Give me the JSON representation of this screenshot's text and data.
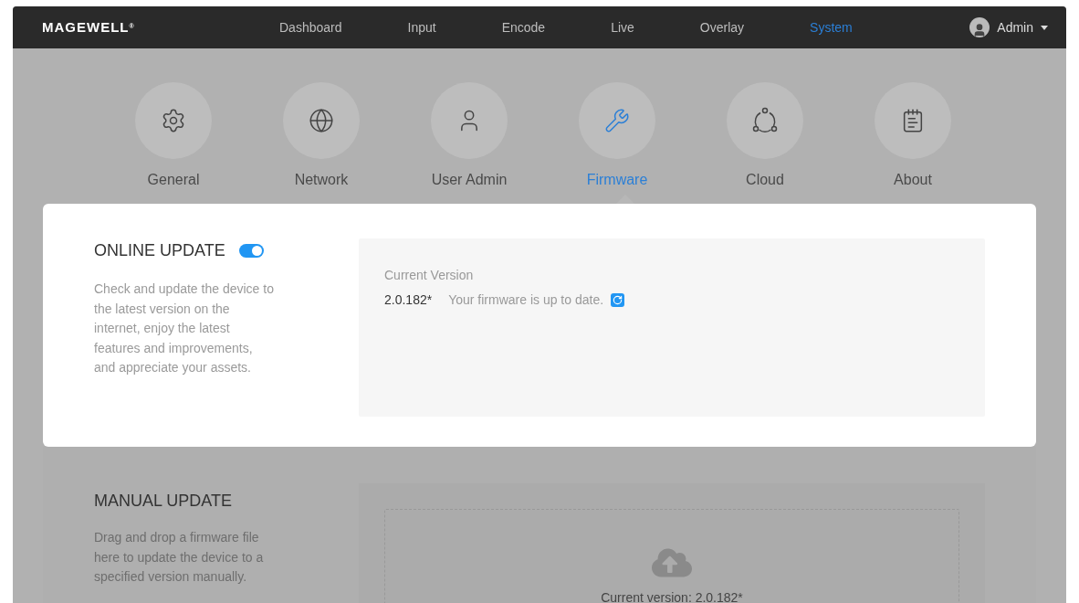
{
  "brand": "MAGEWELL",
  "brand_mark": "®",
  "nav": [
    {
      "label": "Dashboard",
      "selected": false
    },
    {
      "label": "Input",
      "selected": false
    },
    {
      "label": "Encode",
      "selected": false
    },
    {
      "label": "Live",
      "selected": false
    },
    {
      "label": "Overlay",
      "selected": false
    },
    {
      "label": "System",
      "selected": true
    }
  ],
  "user": {
    "name": "Admin"
  },
  "system_tabs": [
    {
      "kind": "gear",
      "label": "General",
      "selected": false
    },
    {
      "kind": "globe",
      "label": "Network",
      "selected": false
    },
    {
      "kind": "user",
      "label": "User Admin",
      "selected": false
    },
    {
      "kind": "tools",
      "label": "Firmware",
      "selected": true
    },
    {
      "kind": "nodes",
      "label": "Cloud",
      "selected": false
    },
    {
      "kind": "document",
      "label": "About",
      "selected": false
    }
  ],
  "online_update": {
    "title": "ONLINE UPDATE",
    "on": true,
    "description": "Check and update the device to the latest version on the internet, enjoy the latest features and improvements, and appreciate your assets.",
    "current_version_label": "Current Version",
    "version": "2.0.182*",
    "status": "Your firmware is up to date."
  },
  "manual_update": {
    "title": "MANUAL UPDATE",
    "description": "Drag and drop a firmware file here to update the device to a specified version manually.",
    "current_version": "Current version: 2.0.182*"
  }
}
